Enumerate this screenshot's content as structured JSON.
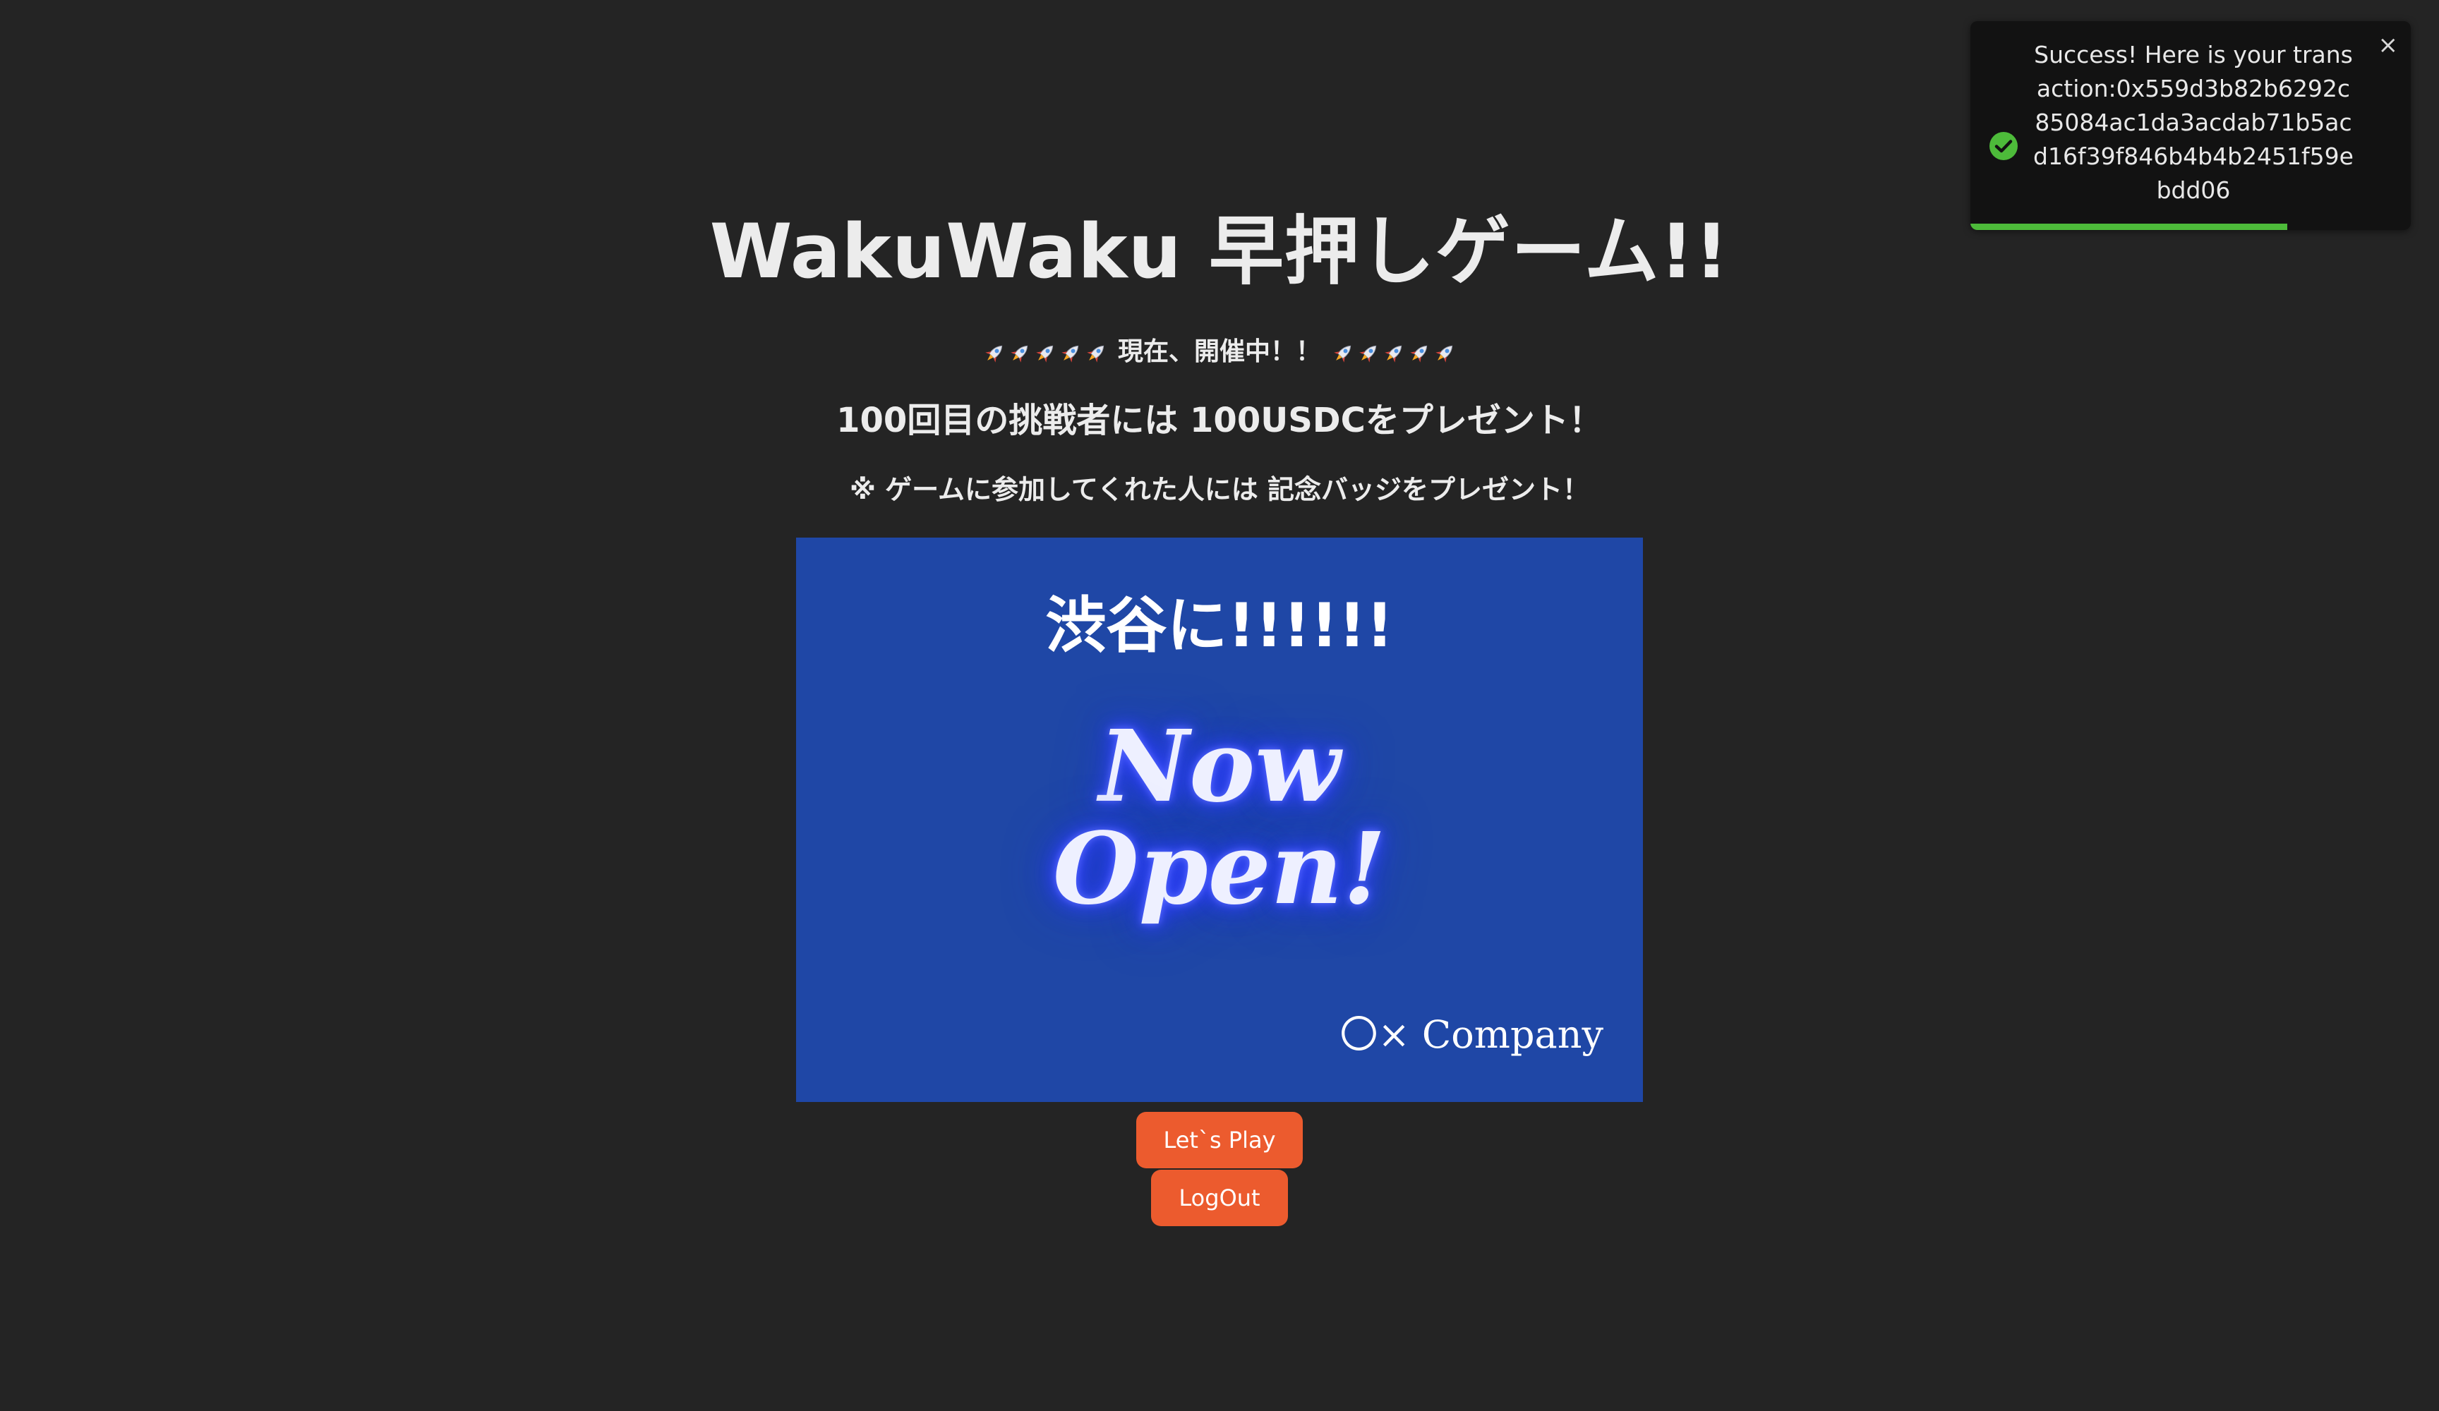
{
  "header": {
    "title": "WakuWaku 早押しゲーム!!",
    "status_text": "現在、開催中！！",
    "prize_text": "100回目の挑戦者には 100USDCをプレゼント！",
    "badge_note": "※ ゲームに参加してくれた人には 記念バッジをプレゼント！"
  },
  "banner": {
    "headline": "渋谷に!!!!!!",
    "neon_line_1": "Now",
    "neon_line_2": "Open!",
    "company": "〇× Company",
    "background_color": "#1f47a6"
  },
  "buttons": {
    "play_label": "Let`s Play",
    "logout_label": "LogOut",
    "color": "#ec5b2e"
  },
  "toast": {
    "message": "Success! Here is your transaction:0x559d3b82b6292c85084ac1da3acdab71b5acd16f39f846b4b4b2451f59ebdd06",
    "close_symbol": "×",
    "status_icon": "success-check-icon",
    "progress": 0.72,
    "progress_color": "#4dbb3a"
  },
  "decorations": {
    "rocket_icon": "rocket-icon",
    "rockets_per_side": 5
  }
}
